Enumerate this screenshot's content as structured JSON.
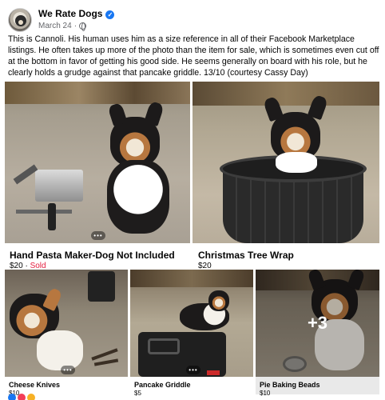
{
  "header": {
    "page_name": "We Rate Dogs",
    "date": "March 24",
    "separator": "·"
  },
  "post": {
    "text": "This is Cannoli. His human uses him as a size reference in all of their Facebook Marketplace listings. He often takes up more of the photo than the item for sale, which is sometimes even cut off at the bottom in favor of getting his good side. He seems generally on board with his role, but he clearly holds a grudge against that pancake griddle. 13/10 (courtesy Cassy Day)"
  },
  "listings": [
    {
      "title": "Hand Pasta Maker-Dog Not Included",
      "price": "$20",
      "price_sep": " · ",
      "status": "Sold"
    },
    {
      "title": "Christmas Tree Wrap",
      "price": "$20"
    },
    {
      "title": "Cheese Knives",
      "price": "$10"
    },
    {
      "title": "Pancake Griddle",
      "price": "$5"
    },
    {
      "title": "Pie Baking Beads",
      "price": "$10",
      "more_count": "+3"
    }
  ],
  "ui": {
    "more_dots": "•••",
    "verified_icon": "check-badge",
    "globe_icon": "globe",
    "colors": {
      "verified": "#1877f2",
      "sold": "#e41e3f",
      "meta": "#65676b"
    }
  }
}
